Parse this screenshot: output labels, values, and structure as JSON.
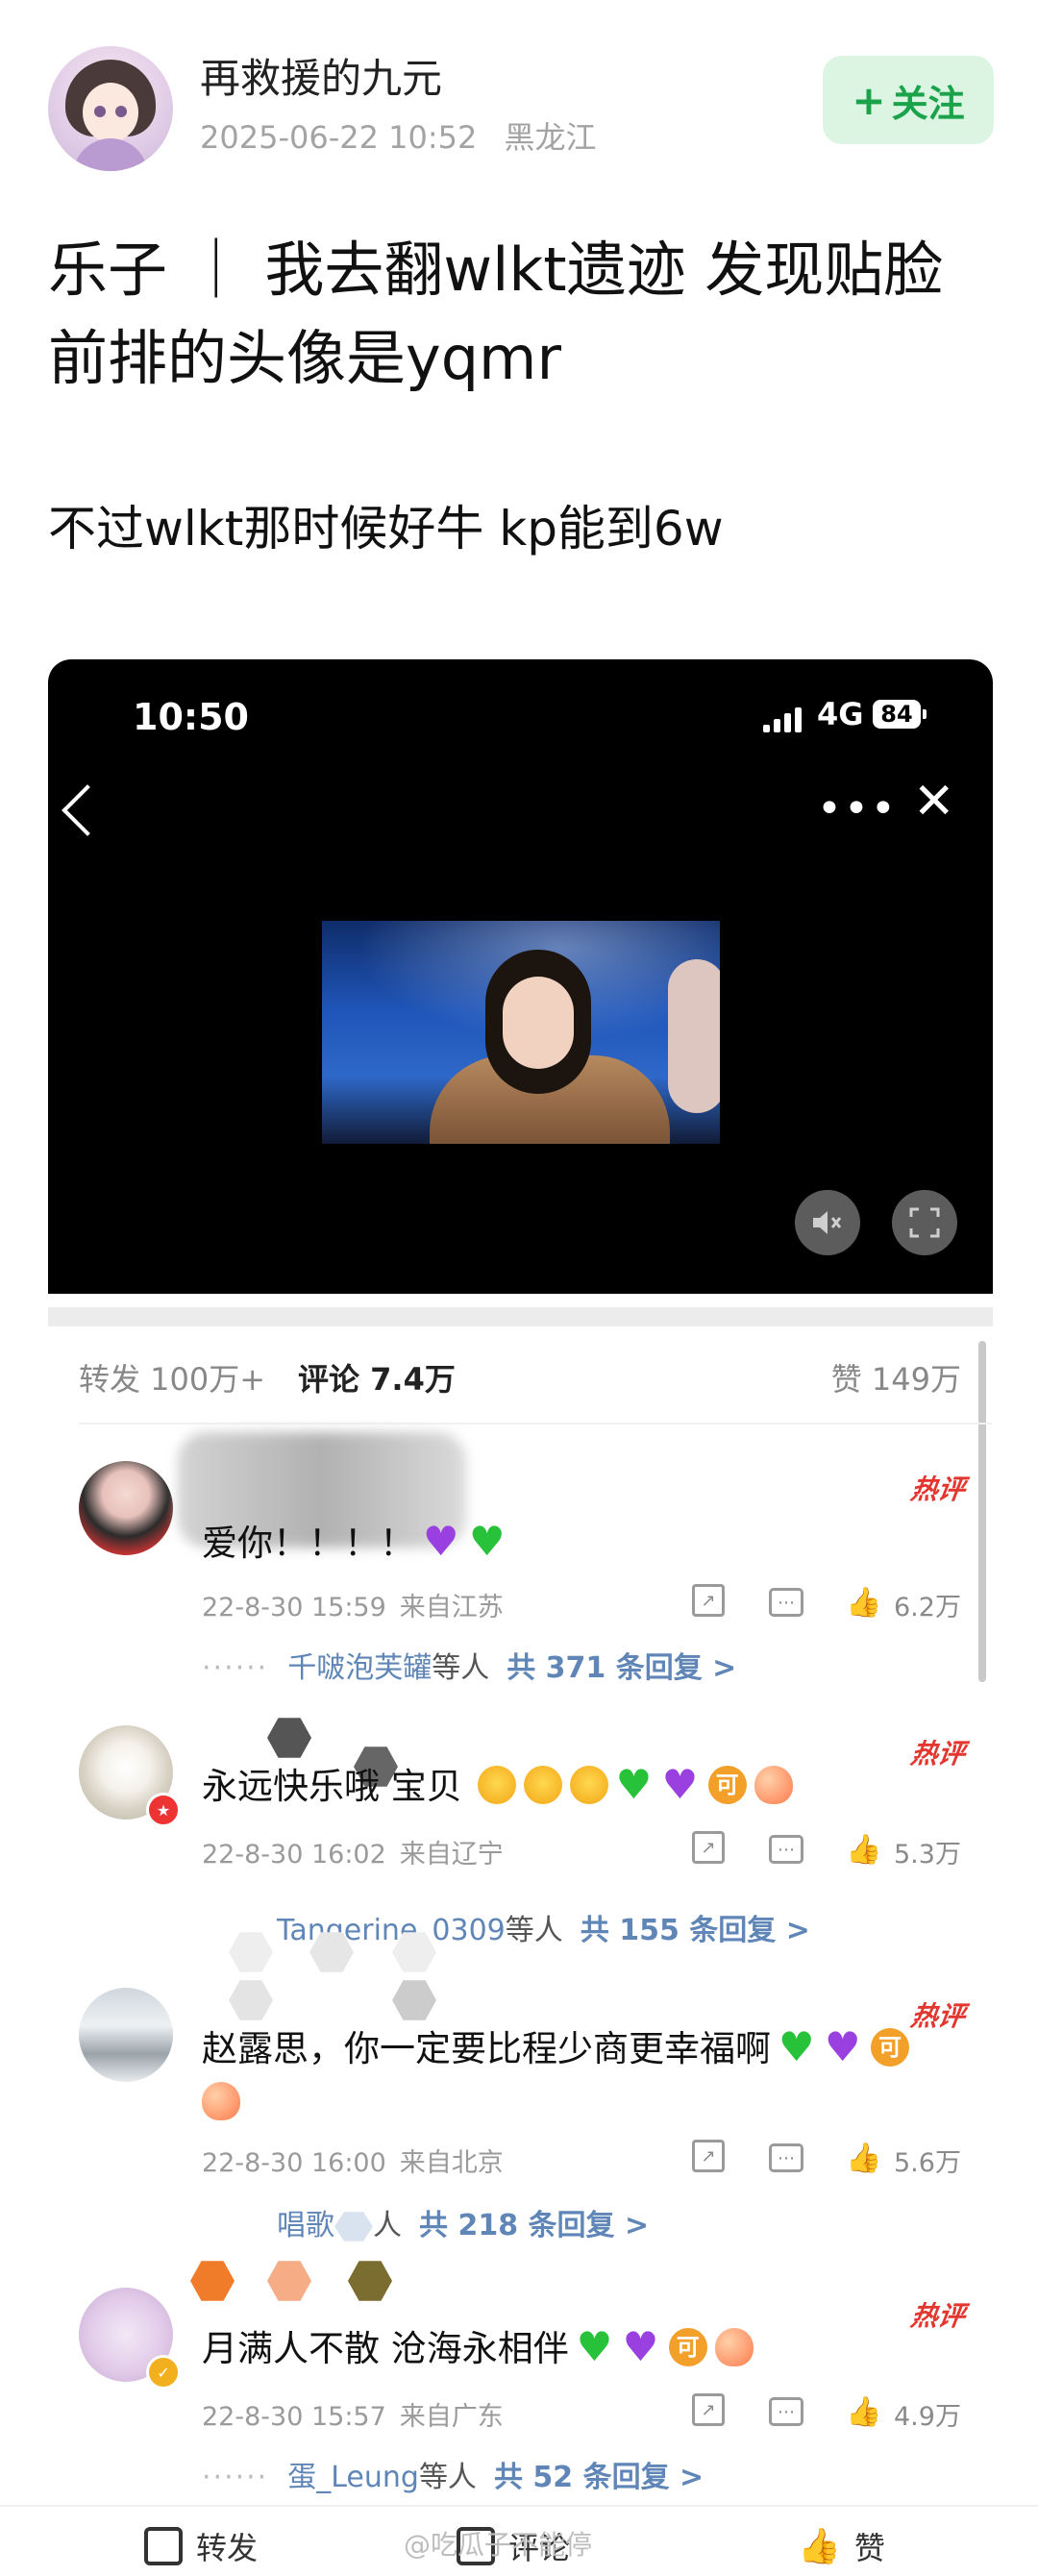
{
  "post": {
    "author": "再救援的九元",
    "timestamp": "2025-06-22 10:52",
    "location": "黑龙江",
    "follow_label": "关注",
    "title": "乐子 ｜ 我去翻wlkt遗迹 发现贴脸前排的头像是yqmr",
    "body": "不过wlkt那时候好牛 kp能到6w"
  },
  "video": {
    "status_time": "10:50",
    "network": "4G",
    "battery": "84",
    "more_glyph": "•••",
    "close_glyph": "✕"
  },
  "stats": {
    "repost": "转发 100万+",
    "comments": "评论 7.4万",
    "likes": "赞 149万"
  },
  "comments": [
    {
      "hot_label": "热评",
      "text": "爱你！！！！",
      "date": "22-8-30 15:59",
      "region": "来自江苏",
      "likes": "6.2万",
      "reply_users": "千啵泡芙罐",
      "reply_suffix": "等人",
      "reply_total": "共 371 条回复 >"
    },
    {
      "hot_label": "热评",
      "text": "永远快乐哦 宝贝",
      "date": "22-8-30 16:02",
      "region": "来自辽宁",
      "likes": "5.3万",
      "reply_users": "Tangerine_0309",
      "reply_suffix": "等人",
      "reply_total": "共 155 条回复 >"
    },
    {
      "hot_label": "热评",
      "text": "赵露思，你一定要比程少商更幸福啊",
      "date": "22-8-30 16:00",
      "region": "来自北京",
      "likes": "5.6万",
      "reply_users": "唱歌",
      "reply_suffix": "人",
      "reply_total": "共 218 条回复 >"
    },
    {
      "hot_label": "热评",
      "text": "月满人不散 沧海永相伴",
      "date": "22-8-30 15:57",
      "region": "来自广东",
      "likes": "4.9万",
      "reply_users": "蛋_Leung",
      "reply_suffix": "等人",
      "reply_total": "共 52 条回复 >"
    }
  ],
  "emoji": {
    "ke": "可"
  },
  "bottom_bar": {
    "repost": "转发",
    "comment": "评论",
    "like": "赞",
    "watermark": "@吃瓜子不能停"
  },
  "colors": {
    "follow_bg": "#dcf5e3",
    "follow_text": "#1aa34a",
    "hot": "#e3362f",
    "reply_link": "#5f86b7"
  }
}
